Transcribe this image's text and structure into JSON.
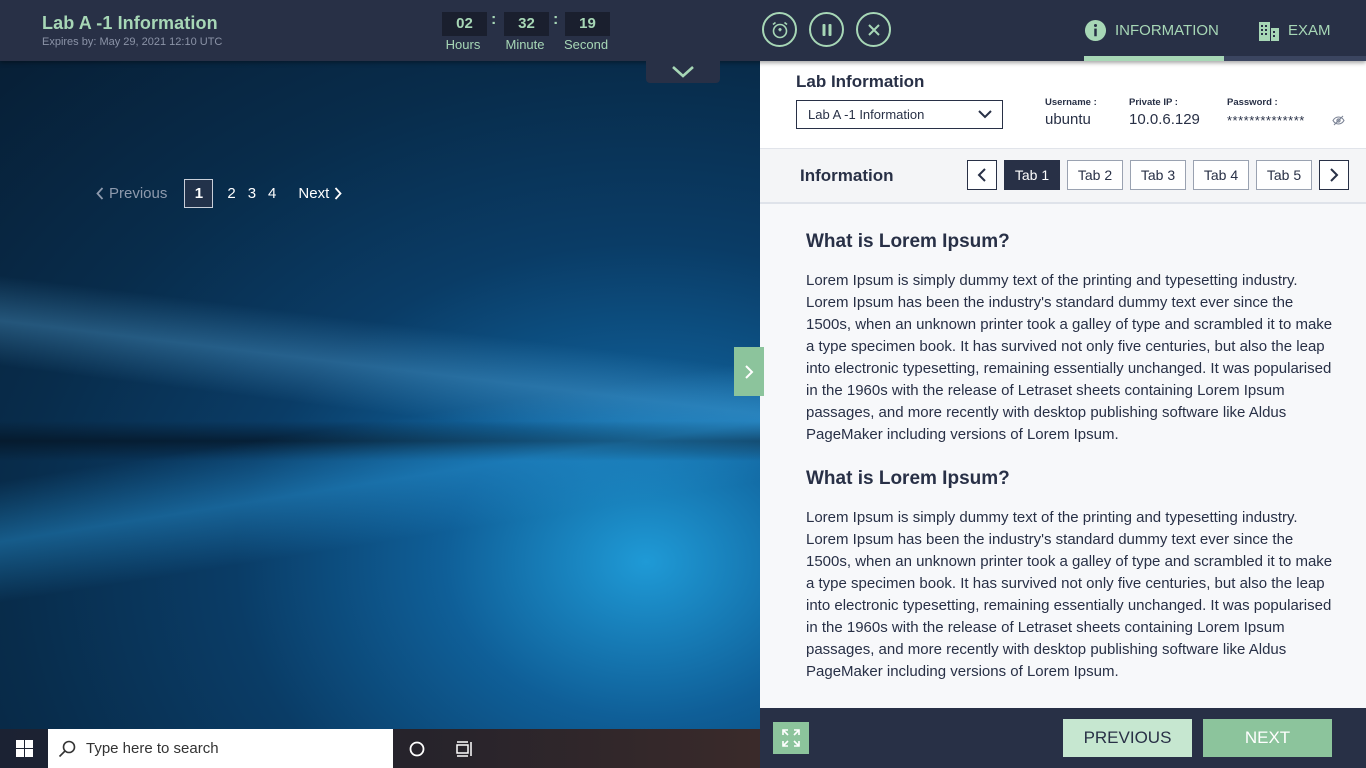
{
  "header": {
    "title": "Lab A -1 Information",
    "expires": "Expires by: May 29, 2021 12:10 UTC"
  },
  "timer": {
    "hours": "02",
    "minutes": "32",
    "seconds": "19",
    "hours_label": "Hours",
    "minutes_label": "Minute",
    "seconds_label": "Second",
    "separator": ":"
  },
  "controls": {
    "alarm_icon": "alarm-clock-icon",
    "pause_icon": "pause-icon",
    "close_icon": "close-icon"
  },
  "nav": {
    "information_label": "INFORMATION",
    "exam_label": "EXAM"
  },
  "pager": {
    "previous_label": "Previous",
    "pages": [
      "1",
      "2",
      "3",
      "4"
    ],
    "current_page": "1",
    "next_label": "Next"
  },
  "taskbar": {
    "search_placeholder": "Type here to search"
  },
  "lab": {
    "title": "Lab Information",
    "selected_lab": "Lab A -1 Information",
    "username_label": "Username :",
    "username": "ubuntu",
    "private_ip_label": "Private IP :",
    "private_ip": "10.0.6.129",
    "password_label": "Password :",
    "password_masked": "**************"
  },
  "info": {
    "label": "Information",
    "tabs": [
      "Tab 1",
      "Tab 2",
      "Tab 3",
      "Tab 4",
      "Tab 5"
    ],
    "active_tab": "Tab 1"
  },
  "content": {
    "sections": [
      {
        "heading": "What is Lorem Ipsum?",
        "body": "Lorem Ipsum is simply dummy text of the printing and typesetting industry. Lorem Ipsum has been the industry's standard dummy text ever since the 1500s, when an unknown printer took a galley of type and scrambled it to make a type specimen book. It has survived not only five centuries, but also the leap into electronic typesetting, remaining essentially unchanged. It was popularised in the 1960s with the release of Letraset sheets containing Lorem Ipsum passages, and more recently with desktop publishing software like Aldus PageMaker including versions of Lorem Ipsum."
      },
      {
        "heading": "What is Lorem Ipsum?",
        "body": "Lorem Ipsum is simply dummy text of the printing and typesetting industry. Lorem Ipsum has been the industry's standard dummy text ever since the 1500s, when an unknown printer took a galley of type and scrambled it to make a type specimen book. It has survived not only five centuries, but also the leap into electronic typesetting, remaining essentially unchanged. It was popularised in the 1960s with the release of Letraset sheets containing Lorem Ipsum passages, and more recently with desktop publishing software like Aldus PageMaker including versions of Lorem Ipsum."
      }
    ]
  },
  "actions": {
    "previous_label": "PREVIOUS",
    "next_label": "NEXT"
  },
  "colors": {
    "accent": "#a7d7b6",
    "navy": "#283046",
    "green_button": "#8cc49c"
  }
}
